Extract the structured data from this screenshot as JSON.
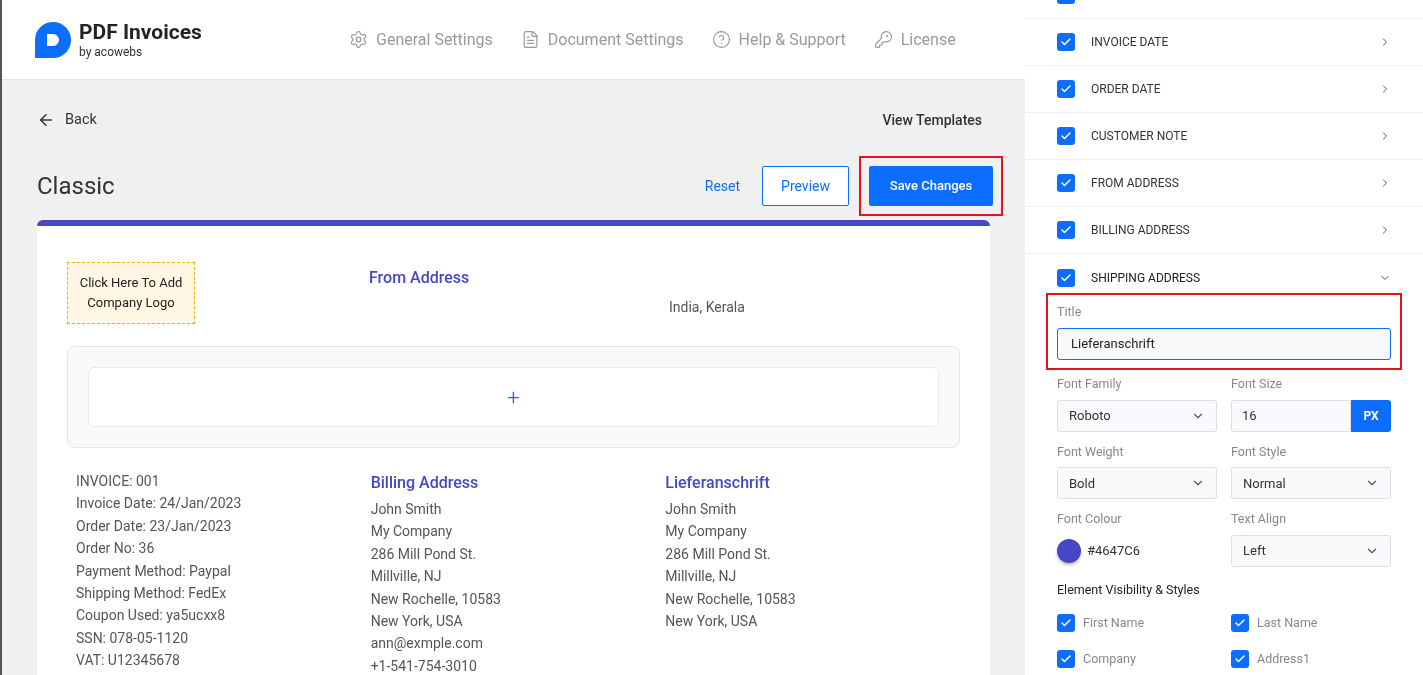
{
  "brand": {
    "name": "PDF Invoices",
    "tagline": "by acowebs"
  },
  "nav": [
    {
      "kind": "gear",
      "label": "General Settings"
    },
    {
      "kind": "document",
      "label": "Document Settings"
    },
    {
      "kind": "help",
      "label": "Help & Support"
    },
    {
      "kind": "key",
      "label": "License"
    }
  ],
  "back": "Back",
  "view_templates": "View Templates",
  "template_name": "Classic",
  "actions": {
    "reset": "Reset",
    "preview": "Preview",
    "save": "Save Changes"
  },
  "invoice": {
    "logo_placeholder": "Click Here To Add Company Logo",
    "from_title": "From Address",
    "from_lines": [
      "India, Kerala"
    ],
    "add_block": "+",
    "details": [
      "INVOICE: 001",
      "Invoice Date: 24/Jan/2023",
      "Order Date: 23/Jan/2023",
      "Order No: 36",
      "Payment Method: Paypal",
      "Shipping Method: FedEx",
      "Coupon Used: ya5ucxx8",
      "SSN: 078-05-1120",
      "VAT: U12345678"
    ],
    "billing": {
      "title": "Billing Address",
      "lines": [
        "John Smith",
        "My Company",
        "286 Mill Pond St.",
        "Millville, NJ",
        "New Rochelle, 10583",
        "New York, USA",
        "ann@exmple.com",
        "+1-541-754-3010"
      ]
    },
    "shipping": {
      "title": "Lieferanschrift",
      "lines": [
        "John Smith",
        "My Company",
        "286 Mill Pond St.",
        "Millville, NJ",
        "New Rochelle, 10583",
        "New York, USA"
      ]
    }
  },
  "sections": [
    {
      "checked": true
    },
    {
      "label": "INVOICE DATE",
      "checked": true,
      "expanded": false
    },
    {
      "label": "ORDER DATE",
      "checked": true,
      "expanded": false
    },
    {
      "label": "CUSTOMER NOTE",
      "checked": true,
      "expanded": false
    },
    {
      "label": "FROM ADDRESS",
      "checked": true,
      "expanded": false
    },
    {
      "label": "BILLING ADDRESS",
      "checked": true,
      "expanded": false
    },
    {
      "label": "SHIPPING ADDRESS",
      "checked": true,
      "expanded": true
    }
  ],
  "editor": {
    "title_label": "Title",
    "title_value": "Lieferanschrift",
    "font_family_label": "Font Family",
    "font_family": "Roboto",
    "font_size_label": "Font Size",
    "font_size": "16",
    "unit": "PX",
    "font_weight_label": "Font Weight",
    "font_weight": "Bold",
    "font_style_label": "Font Style",
    "font_style": "Normal",
    "font_colour_label": "Font Colour",
    "font_colour": "#4647C6",
    "color": "#4647c6",
    "text_align_label": "Text Align",
    "text_align": "Left",
    "visibility_heading": "Element Visibility & Styles",
    "visibility": [
      {
        "label": "First Name",
        "checked": true
      },
      {
        "label": "Last Name",
        "checked": true
      },
      {
        "label": "Company",
        "checked": true
      },
      {
        "label": "Address1",
        "checked": true
      }
    ]
  }
}
